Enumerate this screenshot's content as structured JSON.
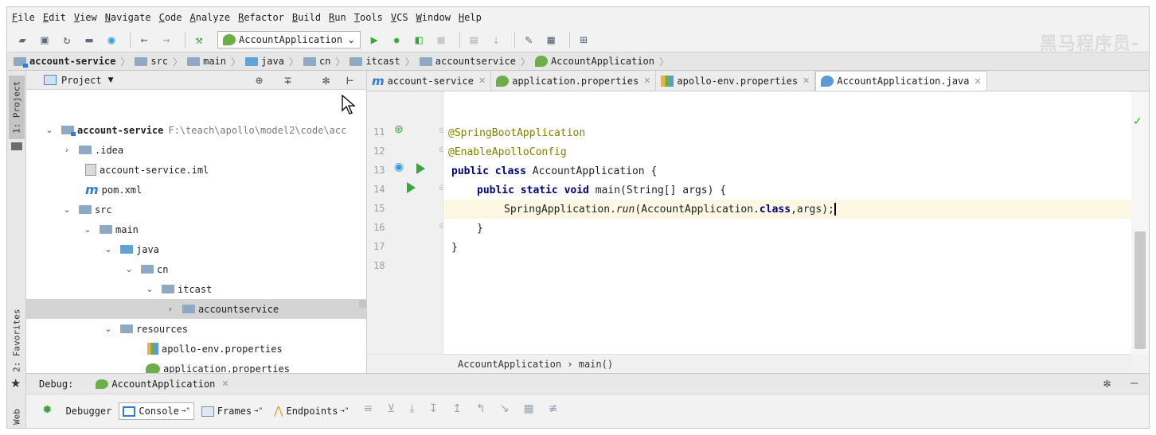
{
  "menu": [
    "File",
    "Edit",
    "View",
    "Navigate",
    "Code",
    "Analyze",
    "Refactor",
    "Build",
    "Run",
    "Tools",
    "VCS",
    "Window",
    "Help"
  ],
  "toolbar": {
    "run_config": "AccountApplication",
    "watermark": "黑马程序员-"
  },
  "breadcrumb": [
    "account-service",
    "src",
    "main",
    "java",
    "cn",
    "itcast",
    "accountservice",
    "AccountApplication"
  ],
  "project": {
    "header": "Project",
    "tree": [
      {
        "label": "account-service",
        "path": "F:\\teach\\apollo\\model2\\code\\acc"
      },
      {
        "label": ".idea"
      },
      {
        "label": "account-service.iml"
      },
      {
        "label": "pom.xml"
      },
      {
        "label": "src"
      },
      {
        "label": "main"
      },
      {
        "label": "java"
      },
      {
        "label": "cn"
      },
      {
        "label": "itcast"
      },
      {
        "label": "accountservice"
      },
      {
        "label": "resources"
      },
      {
        "label": "apollo-env.properties"
      },
      {
        "label": "application.properties"
      }
    ]
  },
  "left_strip": {
    "project_tab": "1: Project",
    "favorites_tab": "2: Favorites",
    "web_tab": "Web"
  },
  "editor": {
    "tabs": [
      "account-service",
      "application.properties",
      "apollo-env.properties",
      "AccountApplication.java"
    ],
    "line_numbers": [
      "11",
      "12",
      "13",
      "14",
      "15",
      "16",
      "17",
      "18"
    ],
    "lines": {
      "l11": "@SpringBootApplication",
      "l12": "@EnableApolloConfig",
      "l13_kw": "public class",
      "l13_rest": " AccountApplication {",
      "l14_kw": "public static void",
      "l14_rest": " main(String[] args) {",
      "l15_a": "SpringApplication.",
      "l15_run": "run",
      "l15_b": "(AccountApplication.",
      "l15_kw": "class",
      "l15_c": ",args);",
      "l16": "}",
      "l17": "}"
    },
    "crumbs": "AccountApplication  ›  main()"
  },
  "debug": {
    "label": "Debug:",
    "session": "AccountApplication",
    "tabs": [
      "Debugger",
      "Console",
      "Frames",
      "Endpoints"
    ]
  },
  "colors": {
    "keyword": "#000080",
    "annotation": "#808000",
    "current_line": "#fcf8e4",
    "run_green": "#3aa53a"
  }
}
